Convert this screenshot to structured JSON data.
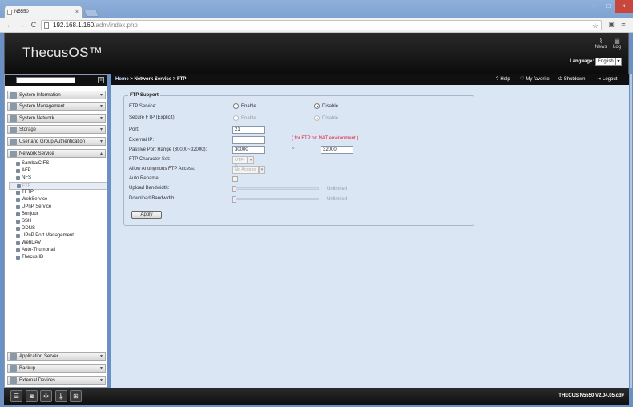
{
  "browser": {
    "tab_title": "N5550",
    "tab_close": "×",
    "url_host": "192.168.1.160",
    "url_path": "/adm/index.php",
    "nav_back": "←",
    "nav_forward": "→",
    "nav_reload": "C",
    "star": "☆",
    "menu": "≡",
    "win_minimize": "–",
    "win_maximize": "□",
    "win_close": "×"
  },
  "header": {
    "logo": "ThecusOS™",
    "news_label": "News",
    "log_label": "Log",
    "language_label": "Language:",
    "language_value": "English",
    "language_arrow": "▾"
  },
  "sidebar": {
    "search_placeholder": "",
    "search_btn": "≡",
    "categories_top": [
      {
        "label": "System Information",
        "arrow": "▾"
      },
      {
        "label": "System Management",
        "arrow": "▾"
      },
      {
        "label": "System Network",
        "arrow": "▾"
      },
      {
        "label": "Storage",
        "arrow": "▾"
      },
      {
        "label": "User and Group Authentication",
        "arrow": "▾"
      },
      {
        "label": "Network Service",
        "arrow": "▴"
      }
    ],
    "items": [
      {
        "label": "Samba/CIFS"
      },
      {
        "label": "AFP"
      },
      {
        "label": "NFS"
      },
      {
        "label": "FTP"
      },
      {
        "label": "TFTP"
      },
      {
        "label": "WebService"
      },
      {
        "label": "UPnP Service"
      },
      {
        "label": "Bonjour"
      },
      {
        "label": "SSH"
      },
      {
        "label": "DDNS"
      },
      {
        "label": "UPnP Port Management"
      },
      {
        "label": "WebDAV"
      },
      {
        "label": "Auto-Thumbnail"
      },
      {
        "label": "Thecus ID"
      }
    ],
    "categories_bottom": [
      {
        "label": "Application Server",
        "arrow": "▾"
      },
      {
        "label": "Backup",
        "arrow": "▾"
      },
      {
        "label": "External Devices",
        "arrow": "▾"
      }
    ]
  },
  "breadcrumb": {
    "home": "Home",
    "rest": " > Network Service > FTP"
  },
  "toplinks": {
    "help": "Help",
    "favorite": "My favorite",
    "shutdown": "Shutdown",
    "logout": "Logout"
  },
  "ftp": {
    "legend": "FTP Support",
    "service_label": "FTP Service:",
    "enable": "Enable",
    "disable": "Disable",
    "service_value": "Disable",
    "secure_label": "Secure FTP (Explicit):",
    "secure_value": "Disable",
    "port_label": "Port:",
    "port_value": "21",
    "external_ip_label": "External IP:",
    "external_ip_value": "",
    "external_ip_note": "( for FTP on NAT environment )",
    "passive_label": "Passive Port Range (30000~32000):",
    "passive_from": "30000",
    "passive_sep": "~",
    "passive_to": "32000",
    "charset_label": "FTP Character Set:",
    "charset_value": "UTF-8",
    "anon_label": "Allow Anonymous FTP Access:",
    "anon_value": "No Access",
    "rename_label": "Auto Rename:",
    "rename_checked": false,
    "upload_label": "Upload Bandwidth:",
    "upload_value": "Unlimited",
    "download_label": "Download Bandwidth:",
    "download_value": "Unlimited",
    "apply": "Apply"
  },
  "footer": {
    "version": "THECUS N5550 V2.04.05.cdv"
  }
}
